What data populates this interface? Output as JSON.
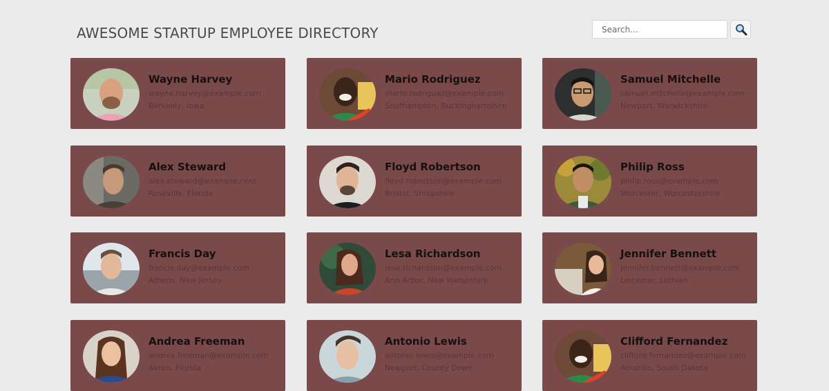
{
  "header": {
    "title": "AWESOME STARTUP EMPLOYEE DIRECTORY",
    "search": {
      "placeholder": "Search...",
      "value": "",
      "button_icon": "magnifier-icon"
    }
  },
  "colors": {
    "background": "#ebebeb",
    "card": "#7a4a4a",
    "name": "#161010",
    "secondary_text": "#5a3636"
  },
  "employees": [
    {
      "name": "Wayne Harvey",
      "email": "wayne.harvey@example.com",
      "location": "Berkeley, Iowa"
    },
    {
      "name": "Mario Rodriguez",
      "email": "mario.rodriguez@example.com",
      "location": "Southampton, Buckinghamshire"
    },
    {
      "name": "Samuel Mitchelle",
      "email": "samuel.mitchelle@example.com",
      "location": "Newport, Warwickshire"
    },
    {
      "name": "Alex Steward",
      "email": "alex.steward@example.com",
      "location": "Roseville, Florida"
    },
    {
      "name": "Floyd Robertson",
      "email": "floyd.robertson@example.com",
      "location": "Bristol, Shropshire"
    },
    {
      "name": "Philip Ross",
      "email": "philip.ross@example.com",
      "location": "Worcester, Worcestershire"
    },
    {
      "name": "Francis Day",
      "email": "francis.day@example.com",
      "location": "Athens, New Jersey"
    },
    {
      "name": "Lesa Richardson",
      "email": "lesa.richardson@example.com",
      "location": "Ann Arbor, New Hampshire"
    },
    {
      "name": "Jennifer Bennett",
      "email": "jennifer.bennett@example.com",
      "location": "Leicester, Lothian"
    },
    {
      "name": "Andrea Freeman",
      "email": "andrea.freeman@example.com",
      "location": "Akron, Florida"
    },
    {
      "name": "Antonio Lewis",
      "email": "antonio.lewis@example.com",
      "location": "Newport, County Down"
    },
    {
      "name": "Clifford Fernandez",
      "email": "clifford.fernandez@example.com",
      "location": "Amarillo, South Dakota"
    }
  ]
}
